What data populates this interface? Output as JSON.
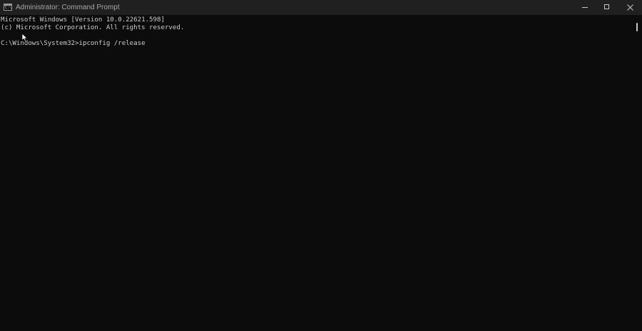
{
  "window": {
    "title": "Administrator: Command Prompt",
    "icon": "cmd-icon",
    "icon_glyph": "C:\\",
    "colors": {
      "titlebar": "#202020",
      "console_bg": "#0c0c0c",
      "console_text": "#cccccc"
    }
  },
  "console": {
    "lines": [
      "Microsoft Windows [Version 10.0.22621.598]",
      "(c) Microsoft Corporation. All rights reserved.",
      "",
      "C:\\Windows\\System32>ipconfig /release"
    ]
  }
}
